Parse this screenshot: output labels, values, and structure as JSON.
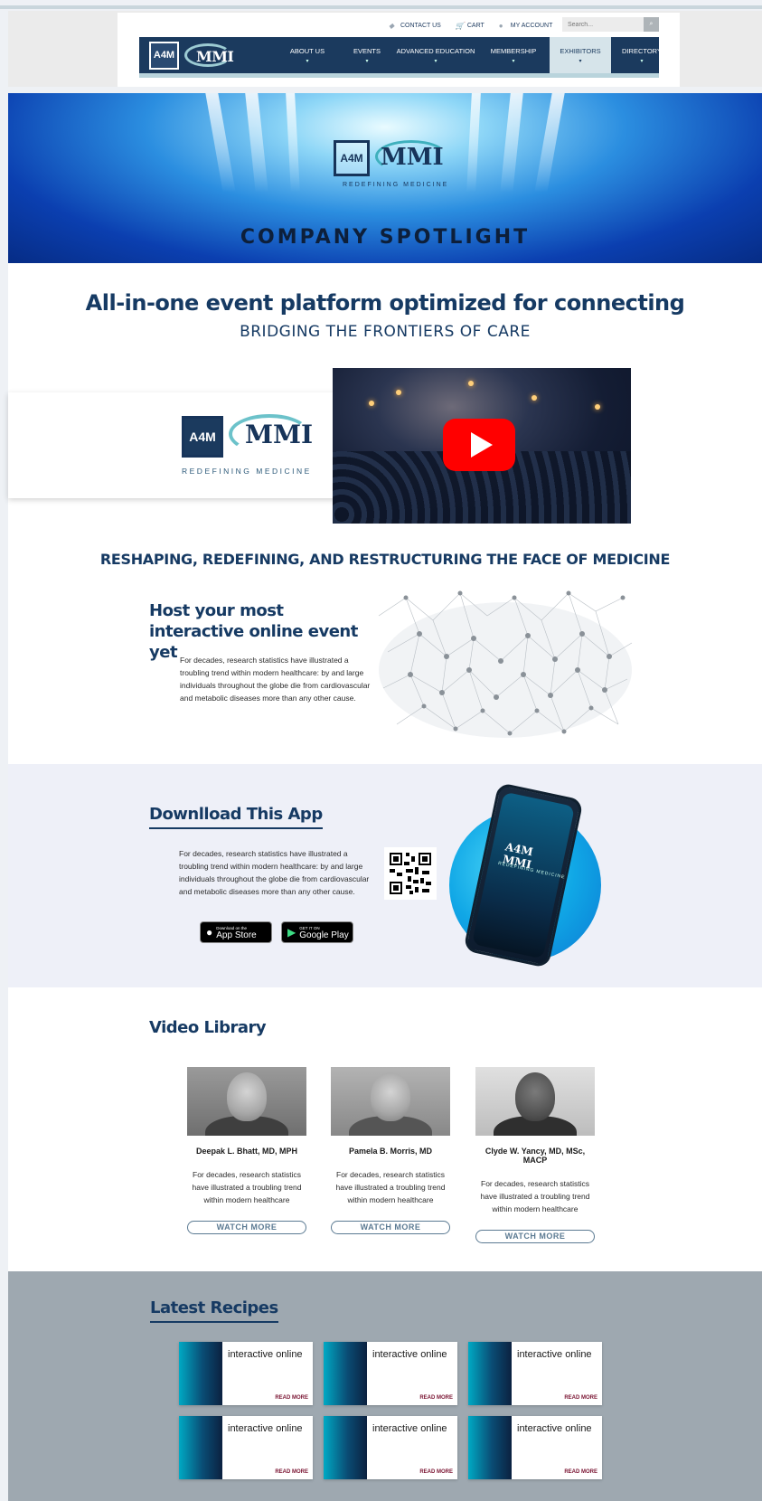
{
  "utility": {
    "contact": "CONTACT US",
    "cart": "CART",
    "account": "MY ACCOUNT",
    "search_placeholder": "Search..."
  },
  "logo": {
    "mark": "A4M",
    "name": "MMI",
    "tagline": "REDEFINING MEDICINE"
  },
  "nav": {
    "items": [
      {
        "label": "ABOUT US"
      },
      {
        "label": "EVENTS"
      },
      {
        "label": "ADVANCED EDUCATION"
      },
      {
        "label": "MEMBERSHIP"
      },
      {
        "label": "EXHIBITORS"
      },
      {
        "label": "DIRECTORY"
      }
    ],
    "active": "EXHIBITORS"
  },
  "hero": {
    "title": "COMPANY SPOTLIGHT"
  },
  "intro": {
    "heading": "All-in-one event platform optimized for connecting",
    "subheading": "BRIDGING THE FRONTIERS OF CARE",
    "reshape": "RESHAPING, REDEFINING, AND RESTRUCTURING THE FACE OF MEDICINE",
    "host_title": "Host your most interactive online event yet",
    "host_text": "For decades, research statistics have illustrated a troubling trend within modern healthcare: by and large individuals throughout the globe die from cardiovascular and metabolic diseases more than any other cause."
  },
  "app": {
    "title": "Downlload This App",
    "text": "For decades, research statistics have illustrated a troubling trend within modern healthcare: by and large individuals throughout the globe die from cardiovascular and metabolic diseases more than any other cause.",
    "appstore_small": "Download on the",
    "appstore_big": "App Store",
    "play_small": "GET IT ON",
    "play_big": "Google Play"
  },
  "videos": {
    "title": "Video Library",
    "people": [
      {
        "name": "Deepak L. Bhatt, MD, MPH",
        "desc": "For decades, research statistics have illustrated a troubling trend within modern healthcare",
        "cta": "WATCH MORE"
      },
      {
        "name": "Pamela B. Morris, MD",
        "desc": "For decades, research statistics have illustrated a troubling trend within modern healthcare",
        "cta": "WATCH MORE"
      },
      {
        "name": "Clyde W. Yancy, MD, MSc, MACP",
        "desc": "For decades, research statistics have illustrated a troubling trend within modern healthcare",
        "cta": "WATCH MORE"
      }
    ]
  },
  "recipes": {
    "title": "Latest Recipes",
    "cards": [
      {
        "title": "interactive online",
        "cta": "READ MORE"
      },
      {
        "title": "interactive online",
        "cta": "READ MORE"
      },
      {
        "title": "interactive online",
        "cta": "READ MORE"
      },
      {
        "title": "interactive online",
        "cta": "READ MORE"
      },
      {
        "title": "interactive online",
        "cta": "READ MORE"
      },
      {
        "title": "interactive online",
        "cta": "READ MORE"
      }
    ]
  },
  "colors": {
    "navy": "#1b3a5e",
    "accent": "#5ab5c8",
    "heading": "#163a63",
    "recipe_link": "#7a1432"
  }
}
